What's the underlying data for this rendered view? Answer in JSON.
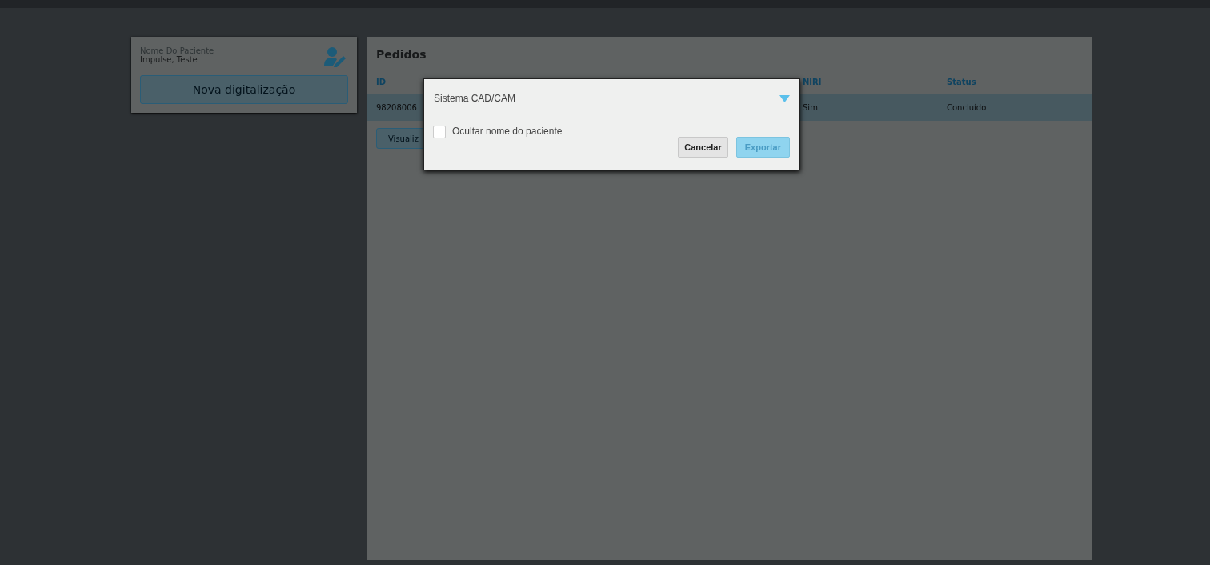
{
  "patient": {
    "label": "Nome Do Paciente",
    "name": "Impulse, Teste",
    "new_scan_button": "Nova digitalização"
  },
  "orders": {
    "title": "Pedidos",
    "columns": [
      "ID",
      "NIRI",
      "Status"
    ],
    "rows": [
      {
        "cells": [
          "98208006",
          "Sim",
          "Concluído"
        ],
        "selected": true
      }
    ],
    "view_button": "Visualiz"
  },
  "dialog": {
    "select_value": "Sistema CAD/CAM",
    "checkbox": {
      "label": "Ocultar nome do paciente",
      "checked": false
    },
    "buttons": [
      {
        "label": "Cancelar",
        "disabled": false
      },
      {
        "label": "Exportar",
        "disabled": true
      }
    ]
  }
}
